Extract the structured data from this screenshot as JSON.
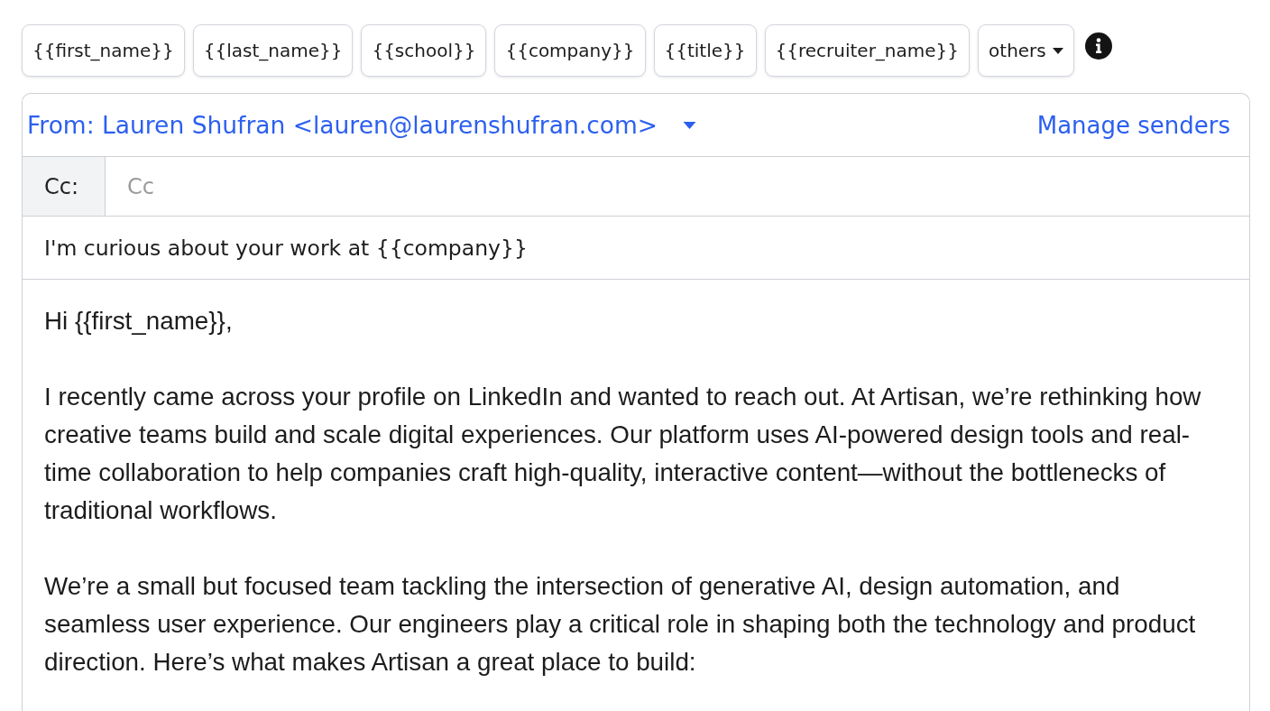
{
  "variables": [
    "{{first_name}}",
    "{{last_name}}",
    "{{school}}",
    "{{company}}",
    "{{title}}",
    "{{recruiter_name}}"
  ],
  "others_menu": {
    "label": "others"
  },
  "composer": {
    "from": {
      "label": "From: Lauren Shufran <lauren@laurenshufran.com>"
    },
    "manage_senders": {
      "label": "Manage senders"
    },
    "cc": {
      "label": "Cc:",
      "placeholder": "Cc"
    },
    "subject": {
      "value": "I'm curious about your work at {{company}}"
    },
    "body": {
      "paragraphs": [
        "Hi {{first_name}},",
        "I recently came across your profile on LinkedIn and wanted to reach out. At Artisan, we’re rethinking how creative teams build and scale digital experiences. Our platform uses AI-powered design tools and real-time collaboration to help companies craft high-quality, interactive content—without the bottlenecks of traditional workflows.",
        "We’re a small but focused team tackling the intersection of generative AI, design automation, and seamless user experience. Our engineers play a critical role in shaping both the technology and product direction. Here’s what makes Artisan a great place to build:"
      ]
    }
  }
}
